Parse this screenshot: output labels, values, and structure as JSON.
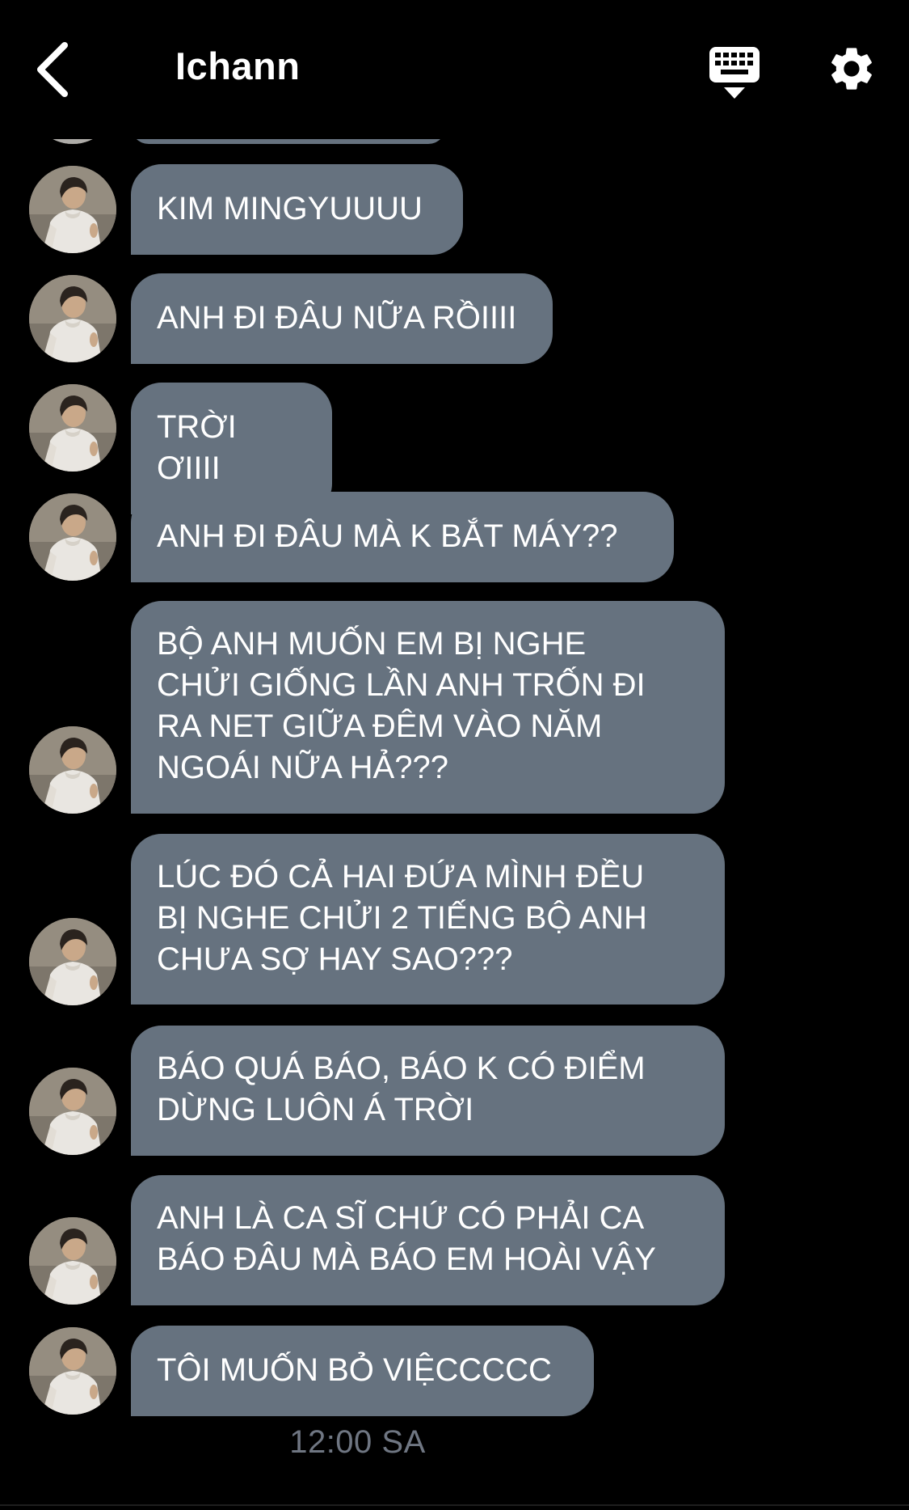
{
  "header": {
    "title": "Ichann",
    "back_icon": "chevron-left-icon",
    "keyboard_icon": "keyboard-dismiss-icon",
    "settings_icon": "gear-icon"
  },
  "messages": [
    {
      "text": "KIM MINGYUUUU"
    },
    {
      "text": "ANH ĐI ĐÂU NỮA RỒIIII"
    },
    {
      "text": "TRỜI ƠIIII"
    },
    {
      "text": "ANH ĐI ĐÂU MÀ K BẮT MÁY??"
    },
    {
      "text": "BỘ ANH MUỐN EM BỊ NGHE\nCHỬI GIỐNG LẦN ANH TRỐN ĐI\nRA NET GIỮA ĐÊM VÀO NĂM\nNGOÁI NỮA HẢ???"
    },
    {
      "text": "LÚC ĐÓ CẢ HAI ĐỨA MÌNH ĐỀU\nBỊ NGHE CHỬI 2 TIẾNG BỘ ANH\nCHƯA SỢ HAY SAO???"
    },
    {
      "text": "BÁO QUÁ BÁO, BÁO K CÓ ĐIỂM\nDỪNG LUÔN Á TRỜI"
    },
    {
      "text": "ANH LÀ CA SĨ CHỨ CÓ PHẢI CA\nBÁO ĐÂU MÀ BÁO EM HOÀI VẬY"
    },
    {
      "text": "TÔI MUỐN BỎ VIỆCCCCC"
    }
  ],
  "timestamp": "12:00 SA",
  "colors": {
    "background": "#000000",
    "bubble": "#66727f",
    "bubble_text": "#ffffff",
    "timestamp": "#6f7682"
  }
}
